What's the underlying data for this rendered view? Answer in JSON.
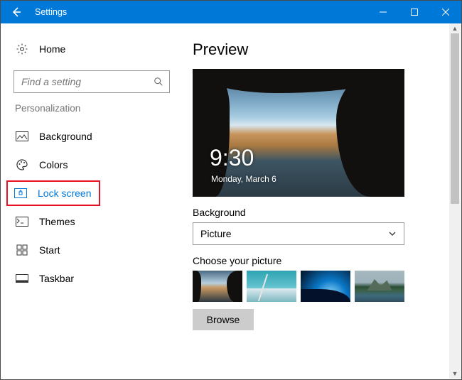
{
  "window": {
    "title": "Settings"
  },
  "sidebar": {
    "home_label": "Home",
    "search_placeholder": "Find a setting",
    "category_label": "Personalization",
    "items": [
      {
        "label": "Background"
      },
      {
        "label": "Colors"
      },
      {
        "label": "Lock screen"
      },
      {
        "label": "Themes"
      },
      {
        "label": "Start"
      },
      {
        "label": "Taskbar"
      }
    ]
  },
  "main": {
    "preview_heading": "Preview",
    "lock_time": "9:30",
    "lock_date": "Monday, March 6",
    "background_label": "Background",
    "background_dropdown_value": "Picture",
    "choose_picture_label": "Choose your picture",
    "browse_label": "Browse"
  },
  "colors": {
    "accent": "#0078d7",
    "highlight_border": "#e81123"
  }
}
